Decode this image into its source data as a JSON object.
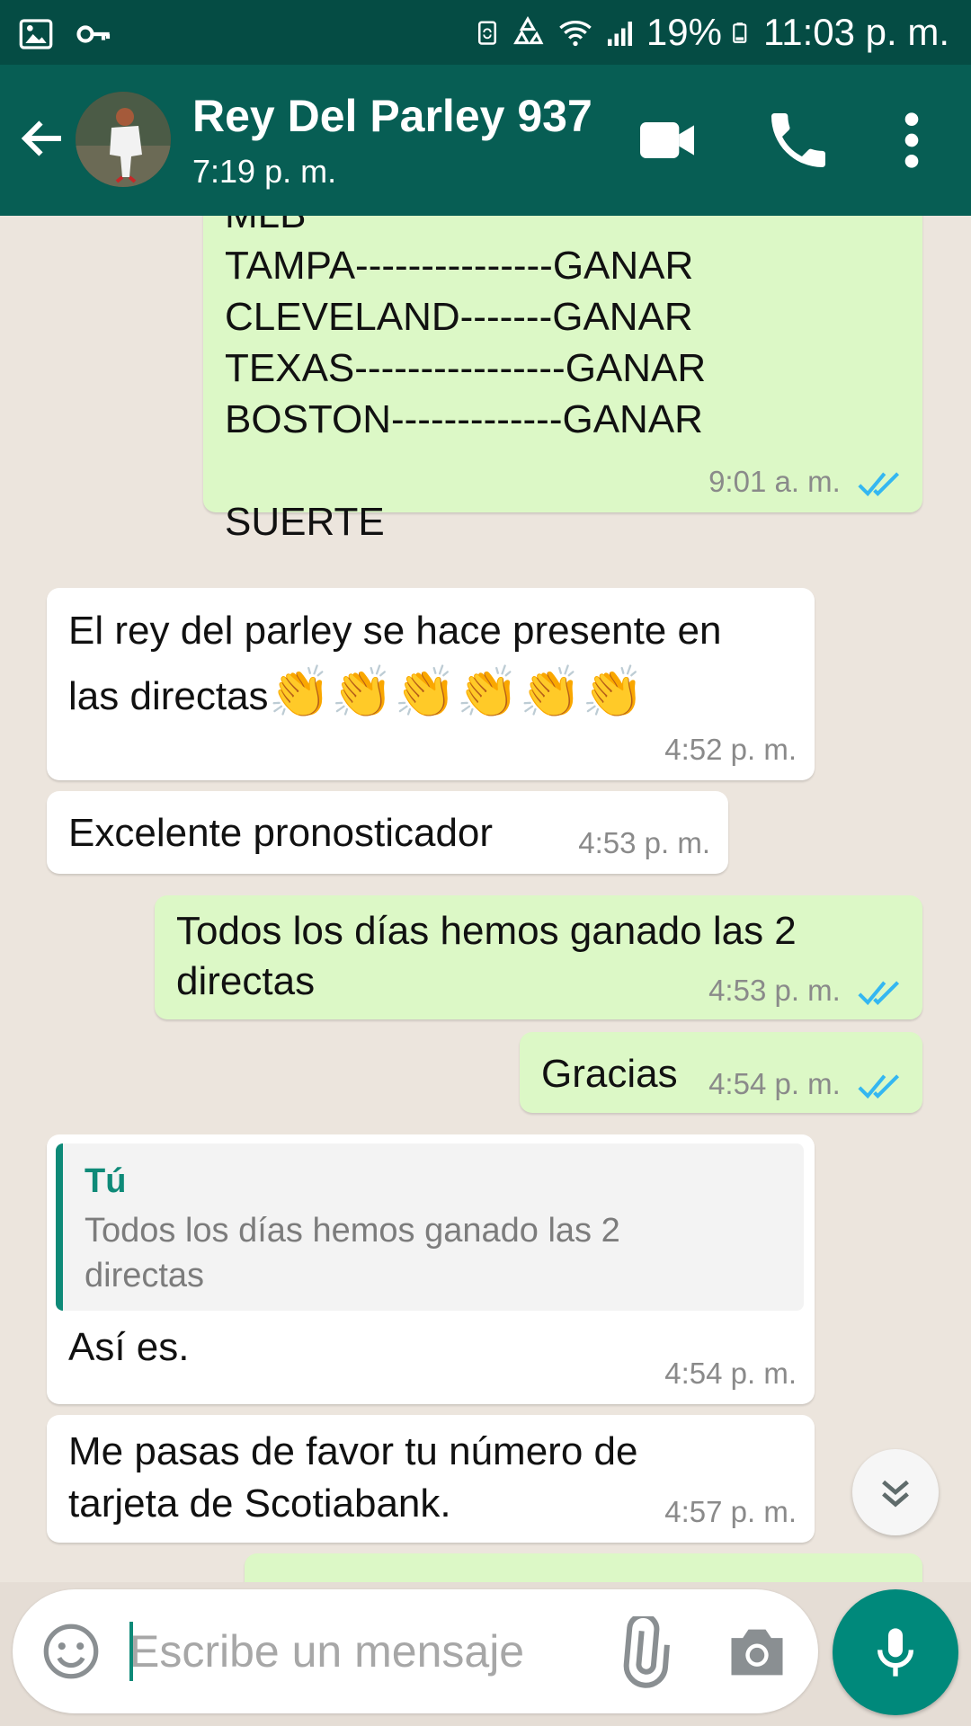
{
  "statusbar": {
    "battery": "19%",
    "time": "11:03 p. m."
  },
  "header": {
    "contact_name": "Rey Del Parley 937",
    "last_seen": "7:19 p. m."
  },
  "messages": {
    "m1": {
      "lines": [
        "MLB",
        "TAMPA---------------GANAR",
        "CLEVELAND-------GANAR",
        "TEXAS----------------GANAR",
        "BOSTON-------------GANAR",
        "",
        "SUERTE"
      ],
      "time": "9:01 a. m."
    },
    "m2": {
      "line1": "El rey del parley se hace presente en",
      "line2": "las directas",
      "emoji": "👏👏👏👏👏👏",
      "time": "4:52 p. m."
    },
    "m3": {
      "text": "Excelente pronosticador",
      "time": "4:53 p. m."
    },
    "m4": {
      "line1": "Todos los días hemos ganado las 2",
      "line2": "directas",
      "time": "4:53 p. m."
    },
    "m5": {
      "text": "Gracias",
      "time": "4:54 p. m."
    },
    "m6": {
      "quote_author": "Tú",
      "quote_line1": "Todos los días hemos ganado las 2",
      "quote_line2": "directas",
      "text": "Así es.",
      "time": "4:54 p. m."
    },
    "m7": {
      "line1": "Me pasas de favor tu número de",
      "line2": "tarjeta de Scotiabank.",
      "time": "4:57 p. m."
    }
  },
  "composer": {
    "placeholder": "Escribe un mensaje"
  },
  "colors": {
    "header": "#075e54",
    "statusbar": "#054c44",
    "outgoing": "#dcf8c6",
    "incoming": "#ffffff",
    "accent": "#00897b",
    "read_ticks": "#34b7f1"
  },
  "icons": [
    "gallery-icon",
    "key-icon",
    "wifi-icon",
    "signal-icon",
    "battery-icon",
    "back-arrow-icon",
    "video-call-icon",
    "phone-icon",
    "more-vert-icon",
    "double-check-icon",
    "chevron-double-down-icon",
    "emoji-icon",
    "attach-icon",
    "camera-icon",
    "mic-icon"
  ]
}
